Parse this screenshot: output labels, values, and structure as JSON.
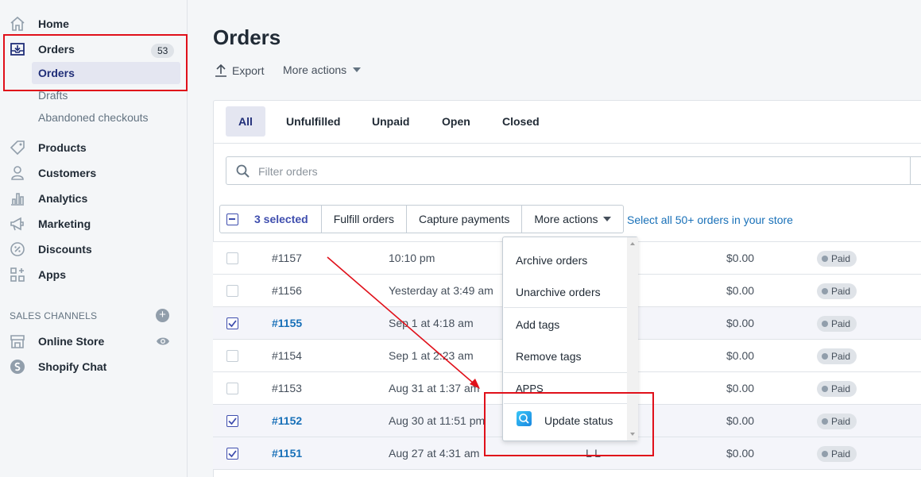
{
  "sidebar": {
    "home": "Home",
    "orders": "Orders",
    "orders_count": "53",
    "sub_orders": "Orders",
    "sub_drafts": "Drafts",
    "sub_abandoned": "Abandoned checkouts",
    "products": "Products",
    "customers": "Customers",
    "analytics": "Analytics",
    "marketing": "Marketing",
    "discounts": "Discounts",
    "apps": "Apps",
    "sales_channels_title": "SALES CHANNELS",
    "online_store": "Online Store",
    "shopify_chat": "Shopify Chat"
  },
  "header": {
    "title": "Orders",
    "export": "Export",
    "more_actions": "More actions"
  },
  "tabs": [
    "All",
    "Unfulfilled",
    "Unpaid",
    "Open",
    "Closed"
  ],
  "filter": {
    "placeholder": "Filter orders"
  },
  "bulk": {
    "selected": "3 selected",
    "fulfill": "Fulfill orders",
    "capture": "Capture payments",
    "more_actions": "More actions",
    "select_all": "Select all 50+ orders in your store"
  },
  "orders": [
    {
      "id": "#1157",
      "date": "10:10 pm",
      "customer": "",
      "total": "$0.00",
      "payment": "Paid",
      "selected": false
    },
    {
      "id": "#1156",
      "date": "Yesterday at 3:49 am",
      "customer": "",
      "total": "$0.00",
      "payment": "Paid",
      "selected": false
    },
    {
      "id": "#1155",
      "date": "Sep 1 at 4:18 am",
      "customer": "",
      "total": "$0.00",
      "payment": "Paid",
      "selected": true
    },
    {
      "id": "#1154",
      "date": "Sep 1 at 2:23 am",
      "customer": "",
      "total": "$0.00",
      "payment": "Paid",
      "selected": false
    },
    {
      "id": "#1153",
      "date": "Aug 31 at 1:37 am",
      "customer": "",
      "total": "$0.00",
      "payment": "Paid",
      "selected": false
    },
    {
      "id": "#1152",
      "date": "Aug 30 at 11:51 pm",
      "customer": "",
      "total": "$0.00",
      "payment": "Paid",
      "selected": true
    },
    {
      "id": "#1151",
      "date": "Aug 27 at 4:31 am",
      "customer": "L L",
      "total": "$0.00",
      "payment": "Paid",
      "selected": true
    }
  ],
  "dropdown": {
    "archive": "Archive orders",
    "unarchive": "Unarchive orders",
    "add_tags": "Add tags",
    "remove_tags": "Remove tags",
    "apps_header": "APPS",
    "update_status": "Update status"
  },
  "colors": {
    "accent": "#202e78",
    "link": "#1870b8",
    "annotation": "#e0101a"
  }
}
